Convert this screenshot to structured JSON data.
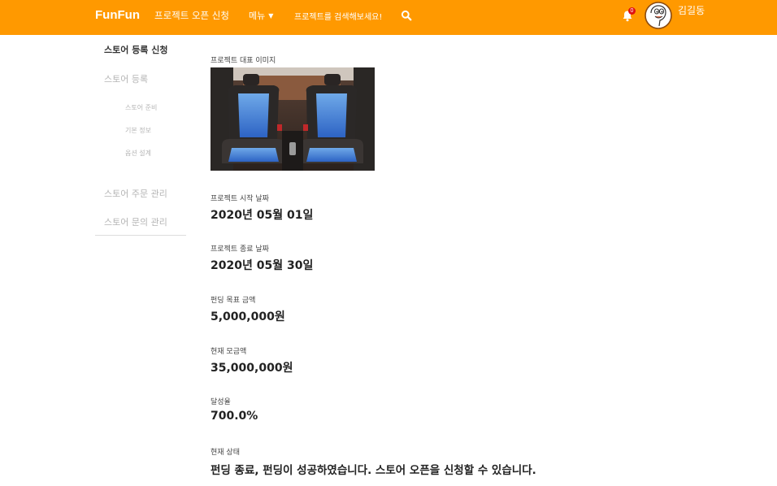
{
  "header": {
    "brand": "FunFun",
    "nav_open_project": "프로젝트 오픈 신청",
    "nav_menu": "메뉴",
    "nav_search_prompt": "프로젝트를 검색해보세요!",
    "notification_count": "0",
    "user_name": "김길동",
    "accent_color": "#ff9900"
  },
  "sidebar": {
    "title": "스토어 등록 신청",
    "items": [
      {
        "label": "스토어 등록"
      },
      {
        "label": "스토어 준비"
      },
      {
        "label": "기본 정보"
      },
      {
        "label": "옵션 설계"
      },
      {
        "label": "스토어 주문 관리"
      },
      {
        "label": "스토어 문의 관리"
      }
    ]
  },
  "main": {
    "image_label": "프로젝트 대표 이미지",
    "image_subject": "car-seat-photo",
    "fields": [
      {
        "label": "프로젝트 시작 날짜",
        "value": "2020년 05월 01일"
      },
      {
        "label": "프로젝트 종료 날짜",
        "value": "2020년 05월 30일"
      },
      {
        "label": "펀딩 목표 금액",
        "value": "5,000,000원"
      },
      {
        "label": "현재 모금액",
        "value": "35,000,000원"
      },
      {
        "label": "달성율",
        "value": "700.0%"
      },
      {
        "label": "현재 상태",
        "value": "펀딩 종료, 펀딩이 성공하였습니다. 스토어 오픈을 신청할 수 있습니다."
      }
    ]
  }
}
